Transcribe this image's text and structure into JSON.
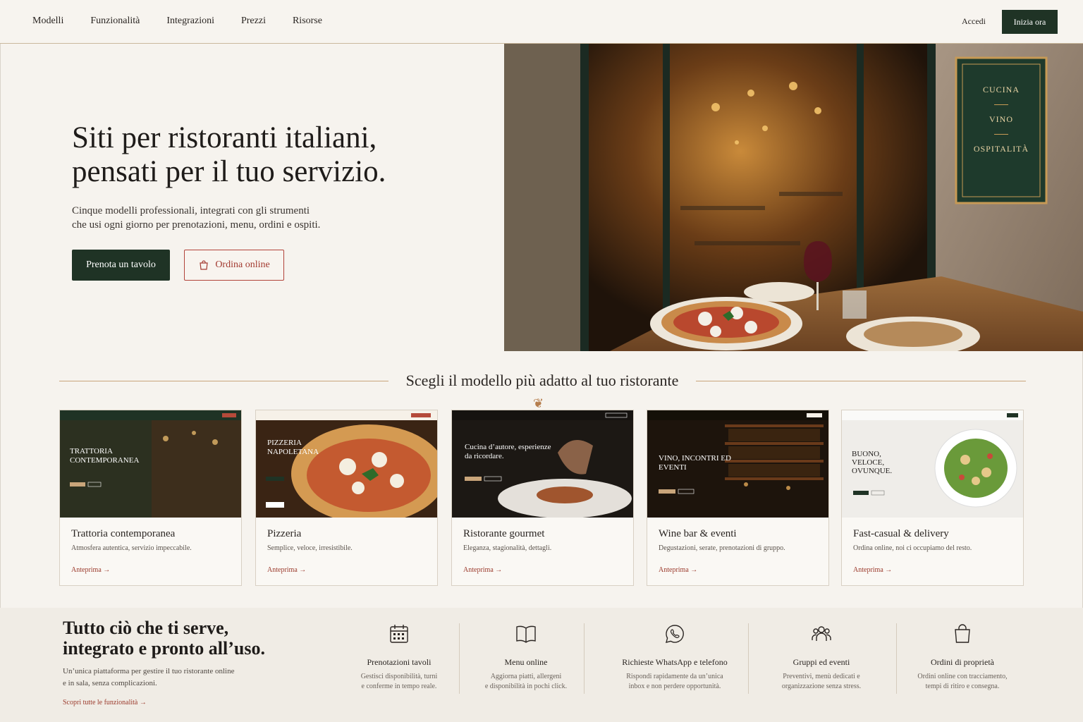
{
  "nav": {
    "links": [
      "Modelli",
      "Funzionalità",
      "Integrazioni",
      "Prezzi",
      "Risorse"
    ],
    "login": "Accedi",
    "cta": "Inizia ora"
  },
  "hero": {
    "title_line1": "Siti per ristoranti italiani,",
    "title_line2": "pensati per il tuo servizio.",
    "subtitle_line1": "Cinque modelli professionali, integrati con gli strumenti",
    "subtitle_line2": "che usi ogni giorno per prenotazioni, menu, ordini e ospiti.",
    "primary_button": "Prenota un tavolo",
    "secondary_button": "Ordina online",
    "sign": [
      "CUCINA",
      "VINO",
      "OSPITALITÀ"
    ]
  },
  "templates": {
    "heading": "Scegli il modello più adatto al tuo ristorante",
    "link_label": "Anteprima",
    "cards": [
      {
        "title": "Trattoria contemporanea",
        "desc": "Atmosfera autentica, servizio impeccabile.",
        "thumb_heading": "TRATTORIA CONTEMPORANEA"
      },
      {
        "title": "Pizzeria",
        "desc": "Semplice, veloce, irresistibile.",
        "thumb_heading": "PIZZERIA NAPOLETANA"
      },
      {
        "title": "Ristorante gourmet",
        "desc": "Eleganza, stagionalità, dettagli.",
        "thumb_heading": "Cucina d’autore, esperienze da ricordare."
      },
      {
        "title": "Wine bar & eventi",
        "desc": "Degustazioni, serate, prenotazioni di gruppo.",
        "thumb_heading": "VINO, INCONTRI ED EVENTI"
      },
      {
        "title": "Fast-casual & delivery",
        "desc": "Ordina online, noi ci occupiamo del resto.",
        "thumb_heading": "BUONO, VELOCE, OVUNQUE."
      }
    ]
  },
  "features": {
    "title_line1": "Tutto ciò che ti serve,",
    "title_line2": "integrato e pronto all’uso.",
    "subtitle_line1": "Un’unica piattaforma per gestire il tuo ristorante online",
    "subtitle_line2": "e in sala, senza complicazioni.",
    "link": "Scopri tutte le funzionalità",
    "items": [
      {
        "title": "Prenotazioni tavoli",
        "desc1": "Gestisci disponibilità, turni",
        "desc2": "e conferme in tempo reale.",
        "icon": "calendar-icon"
      },
      {
        "title": "Menu online",
        "desc1": "Aggiorna piatti, allergeni",
        "desc2": "e disponibilità in pochi click.",
        "icon": "book-icon"
      },
      {
        "title": "Richieste WhatsApp e telefono",
        "desc1": "Rispondi rapidamente da un’unica",
        "desc2": "inbox e non perdere opportunità.",
        "icon": "whatsapp-icon"
      },
      {
        "title": "Gruppi ed eventi",
        "desc1": "Preventivi, menù dedicati e",
        "desc2": "organizzazione senza stress.",
        "icon": "group-icon"
      },
      {
        "title": "Ordini di proprietà",
        "desc1": "Ordini online con tracciamento,",
        "desc2": "tempi di ritiro e consegna.",
        "icon": "shopping-bag-icon"
      }
    ]
  },
  "colors": {
    "accent_green": "#1f3325",
    "accent_red": "#a33b31",
    "gold": "#c9a57a",
    "background": "#f6f3ee"
  }
}
